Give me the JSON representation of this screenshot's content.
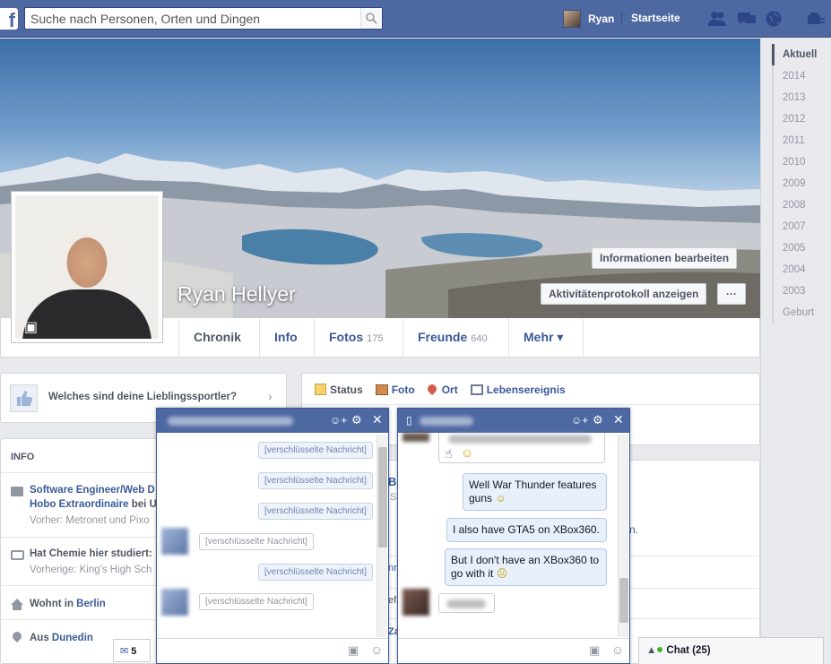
{
  "topbar": {
    "logo": "f",
    "search_placeholder": "Suche nach Personen, Orten und Dingen",
    "user_name": "Ryan",
    "home_label": "Startseite"
  },
  "timeline_years": [
    "Aktuell",
    "2014",
    "2013",
    "2012",
    "2011",
    "2010",
    "2009",
    "2008",
    "2007",
    "2005",
    "2004",
    "2003",
    "Geburt"
  ],
  "profile": {
    "name": "Ryan Hellyer",
    "edit_info_label": "Informationen bearbeiten",
    "activity_log_label": "Aktivitätenprotokoll anzeigen",
    "more_dots": "···"
  },
  "tabs": [
    {
      "label": "Chronik"
    },
    {
      "label": "Info"
    },
    {
      "label": "Fotos",
      "count": "175"
    },
    {
      "label": "Freunde",
      "count": "640"
    },
    {
      "label": "Mehr ▾"
    }
  ],
  "question": {
    "text": "Welches sind deine Lieblingssportler?"
  },
  "info": {
    "heading": "INFO",
    "work_title": "Software Engineer/Web D",
    "work_line2_a": "Hobo Extraordinaire",
    "work_line2_b": " bei U",
    "work_prev": "Vorher: Metronet und Pixo",
    "study_a": "Hat Chemie hier studiert:",
    "study_prev": "Vorherige: King's High Sch",
    "lives_a": "Wohnt in ",
    "lives_b": "Berlin",
    "from_a": "Aus ",
    "from_b": "Dunedin"
  },
  "composer": {
    "status": "Status",
    "photo": "Foto",
    "place": "Ort",
    "life_event": "Lebensereignis"
  },
  "chat1": {
    "encrypted": "[verschlüsselte Nachricht]",
    "notif_count": "5"
  },
  "chat2": {
    "msg1": "Well War Thunder features guns",
    "msg2": "I also have GTA5 on XBox360.",
    "msg3": "But I don't have an XBox360 to go with it"
  },
  "chat_bar": {
    "label": "Chat (25)"
  },
  "feed_fragments": {
    "b": "B",
    "s": "S",
    "n": "n.",
    "nn": "nn",
    "efa": "efä",
    "za": "Za"
  }
}
